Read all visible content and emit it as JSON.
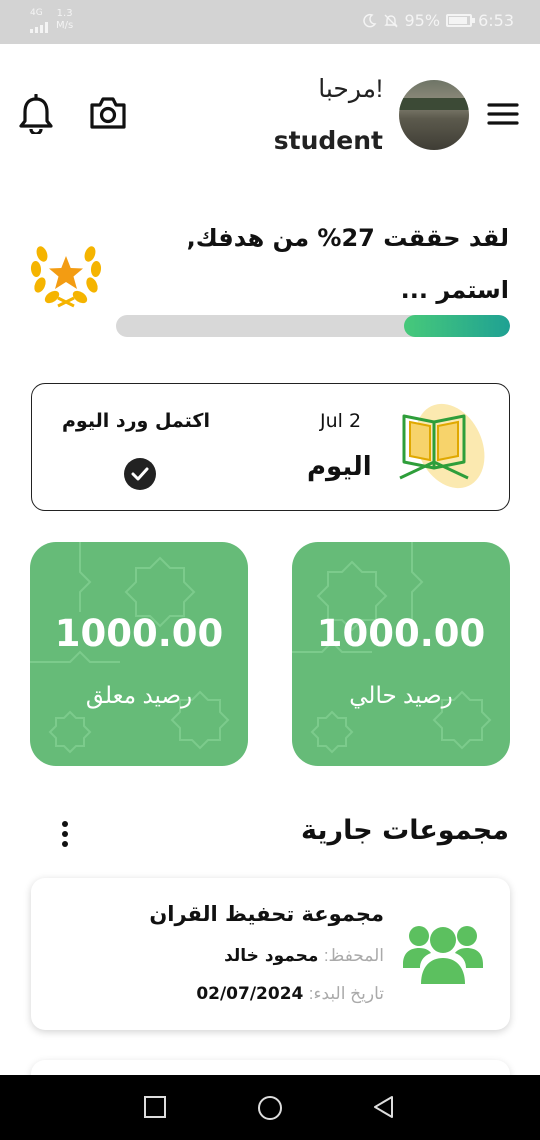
{
  "status_bar": {
    "network": "4G",
    "speed_value": "1.3",
    "speed_unit": "M/s",
    "battery_percent": "95%",
    "time": "6:53",
    "icons": [
      "signal-icon",
      "moon-icon",
      "mute-icon",
      "battery-icon"
    ]
  },
  "header": {
    "greeting": "مرحبا!",
    "username": "student",
    "icons": [
      "bell-icon",
      "camera-icon",
      "menu-icon",
      "avatar"
    ]
  },
  "goal": {
    "line1": "لقد حققت 27% من هدفك,",
    "line2": "استمر ...",
    "progress_percent": 27,
    "icon": "laurel-star-icon",
    "colors": {
      "start": "#47c97a",
      "end": "#1fa193"
    }
  },
  "today": {
    "date": "Jul 2",
    "label": "اليوم",
    "wird_status": "اكتمل ورد اليوم",
    "icon": "quran-icon",
    "status_icon": "check-icon"
  },
  "balances": [
    {
      "amount": "1000.00",
      "label": "رصيد حالي"
    },
    {
      "amount": "1000.00",
      "label": "رصيد معلق"
    }
  ],
  "groups": {
    "title": "مجموعات جارية",
    "items": [
      {
        "name": "مجموعة تحفيظ القران",
        "teacher_key": "المحفظ:",
        "teacher_value": "محمود خالد",
        "start_key": "تاريخ البدء:",
        "start_value": "02/07/2024"
      }
    ]
  },
  "colors": {
    "accent_green": "#66bb78",
    "group_icon": "#5cc05f",
    "medal": "#f5b400"
  }
}
